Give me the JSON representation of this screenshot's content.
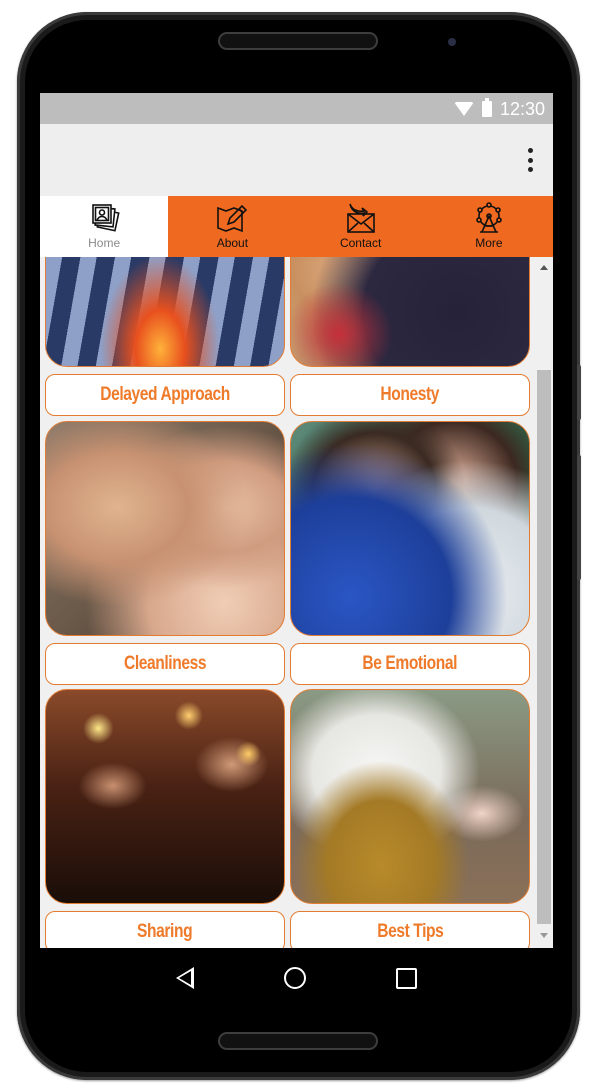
{
  "statusbar": {
    "time": "12:30",
    "wifi_icon": "wifi-icon",
    "battery_icon": "battery-icon"
  },
  "appbar": {
    "menu_icon": "more-vert-icon"
  },
  "tabs": [
    {
      "label": "Home",
      "icon": "photo-album-icon",
      "active": true
    },
    {
      "label": "About",
      "icon": "map-pencil-icon",
      "active": false
    },
    {
      "label": "Contact",
      "icon": "envelope-arrow-icon",
      "active": false
    },
    {
      "label": "More",
      "icon": "ferris-wheel-icon",
      "active": false
    }
  ],
  "cards": [
    {
      "label": "Delayed Approach",
      "image": "chess-board-photo"
    },
    {
      "label": "Honesty",
      "image": "couple-embrace-photo"
    },
    {
      "label": "Cleanliness",
      "image": "couple-bed-photo"
    },
    {
      "label": "Be Emotional",
      "image": "couple-hand-kiss-photo"
    },
    {
      "label": "Sharing",
      "image": "couple-dinner-photo"
    },
    {
      "label": "Best Tips",
      "image": "man-flowers-photo"
    }
  ],
  "colors": {
    "accent": "#ef6a20",
    "label_text": "#ee7a2a",
    "card_border": "#e37c33"
  },
  "navbar": {
    "back": "back-icon",
    "home": "home-circle-icon",
    "recent": "recent-apps-icon"
  }
}
